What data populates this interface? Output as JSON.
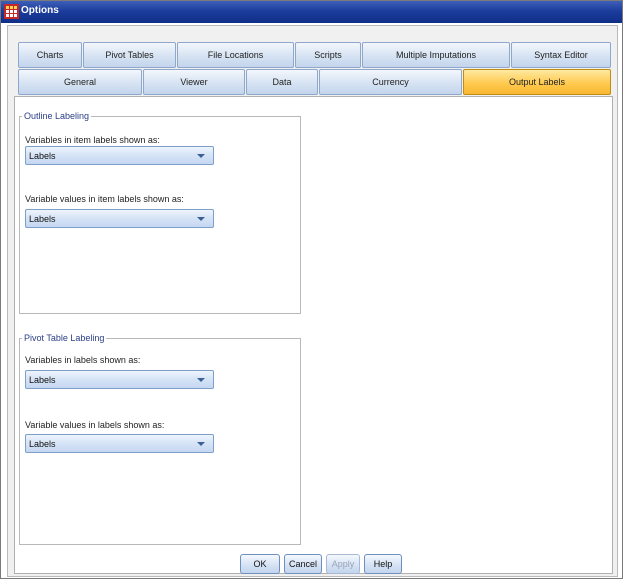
{
  "window": {
    "title": "Options"
  },
  "tabs_row1": [
    "Charts",
    "Pivot Tables",
    "File Locations",
    "Scripts",
    "Multiple Imputations",
    "Syntax Editor"
  ],
  "tabs_row2": [
    "General",
    "Viewer",
    "Data",
    "Currency",
    "Output Labels"
  ],
  "active_tab": "Output Labels",
  "outline_labeling": {
    "legend": "Outline Labeling",
    "variables_label": "Variables in item labels shown as:",
    "variables_value": "Labels",
    "values_label": "Variable values in item labels shown as:",
    "values_value": "Labels"
  },
  "pivot_labeling": {
    "legend": "Pivot Table Labeling",
    "variables_label": "Variables in labels shown as:",
    "variables_value": "Labels",
    "values_label": "Variable values in labels shown as:",
    "values_value": "Labels"
  },
  "buttons": {
    "ok": "OK",
    "cancel": "Cancel",
    "apply": "Apply",
    "help": "Help"
  },
  "colors": {
    "titlebar": "#1c3d9c",
    "active_tab": "#ffc84a",
    "legend_text": "#2b3f87"
  },
  "icons": {
    "app": "table-grid-icon",
    "dropdown": "chevron-down-icon"
  }
}
